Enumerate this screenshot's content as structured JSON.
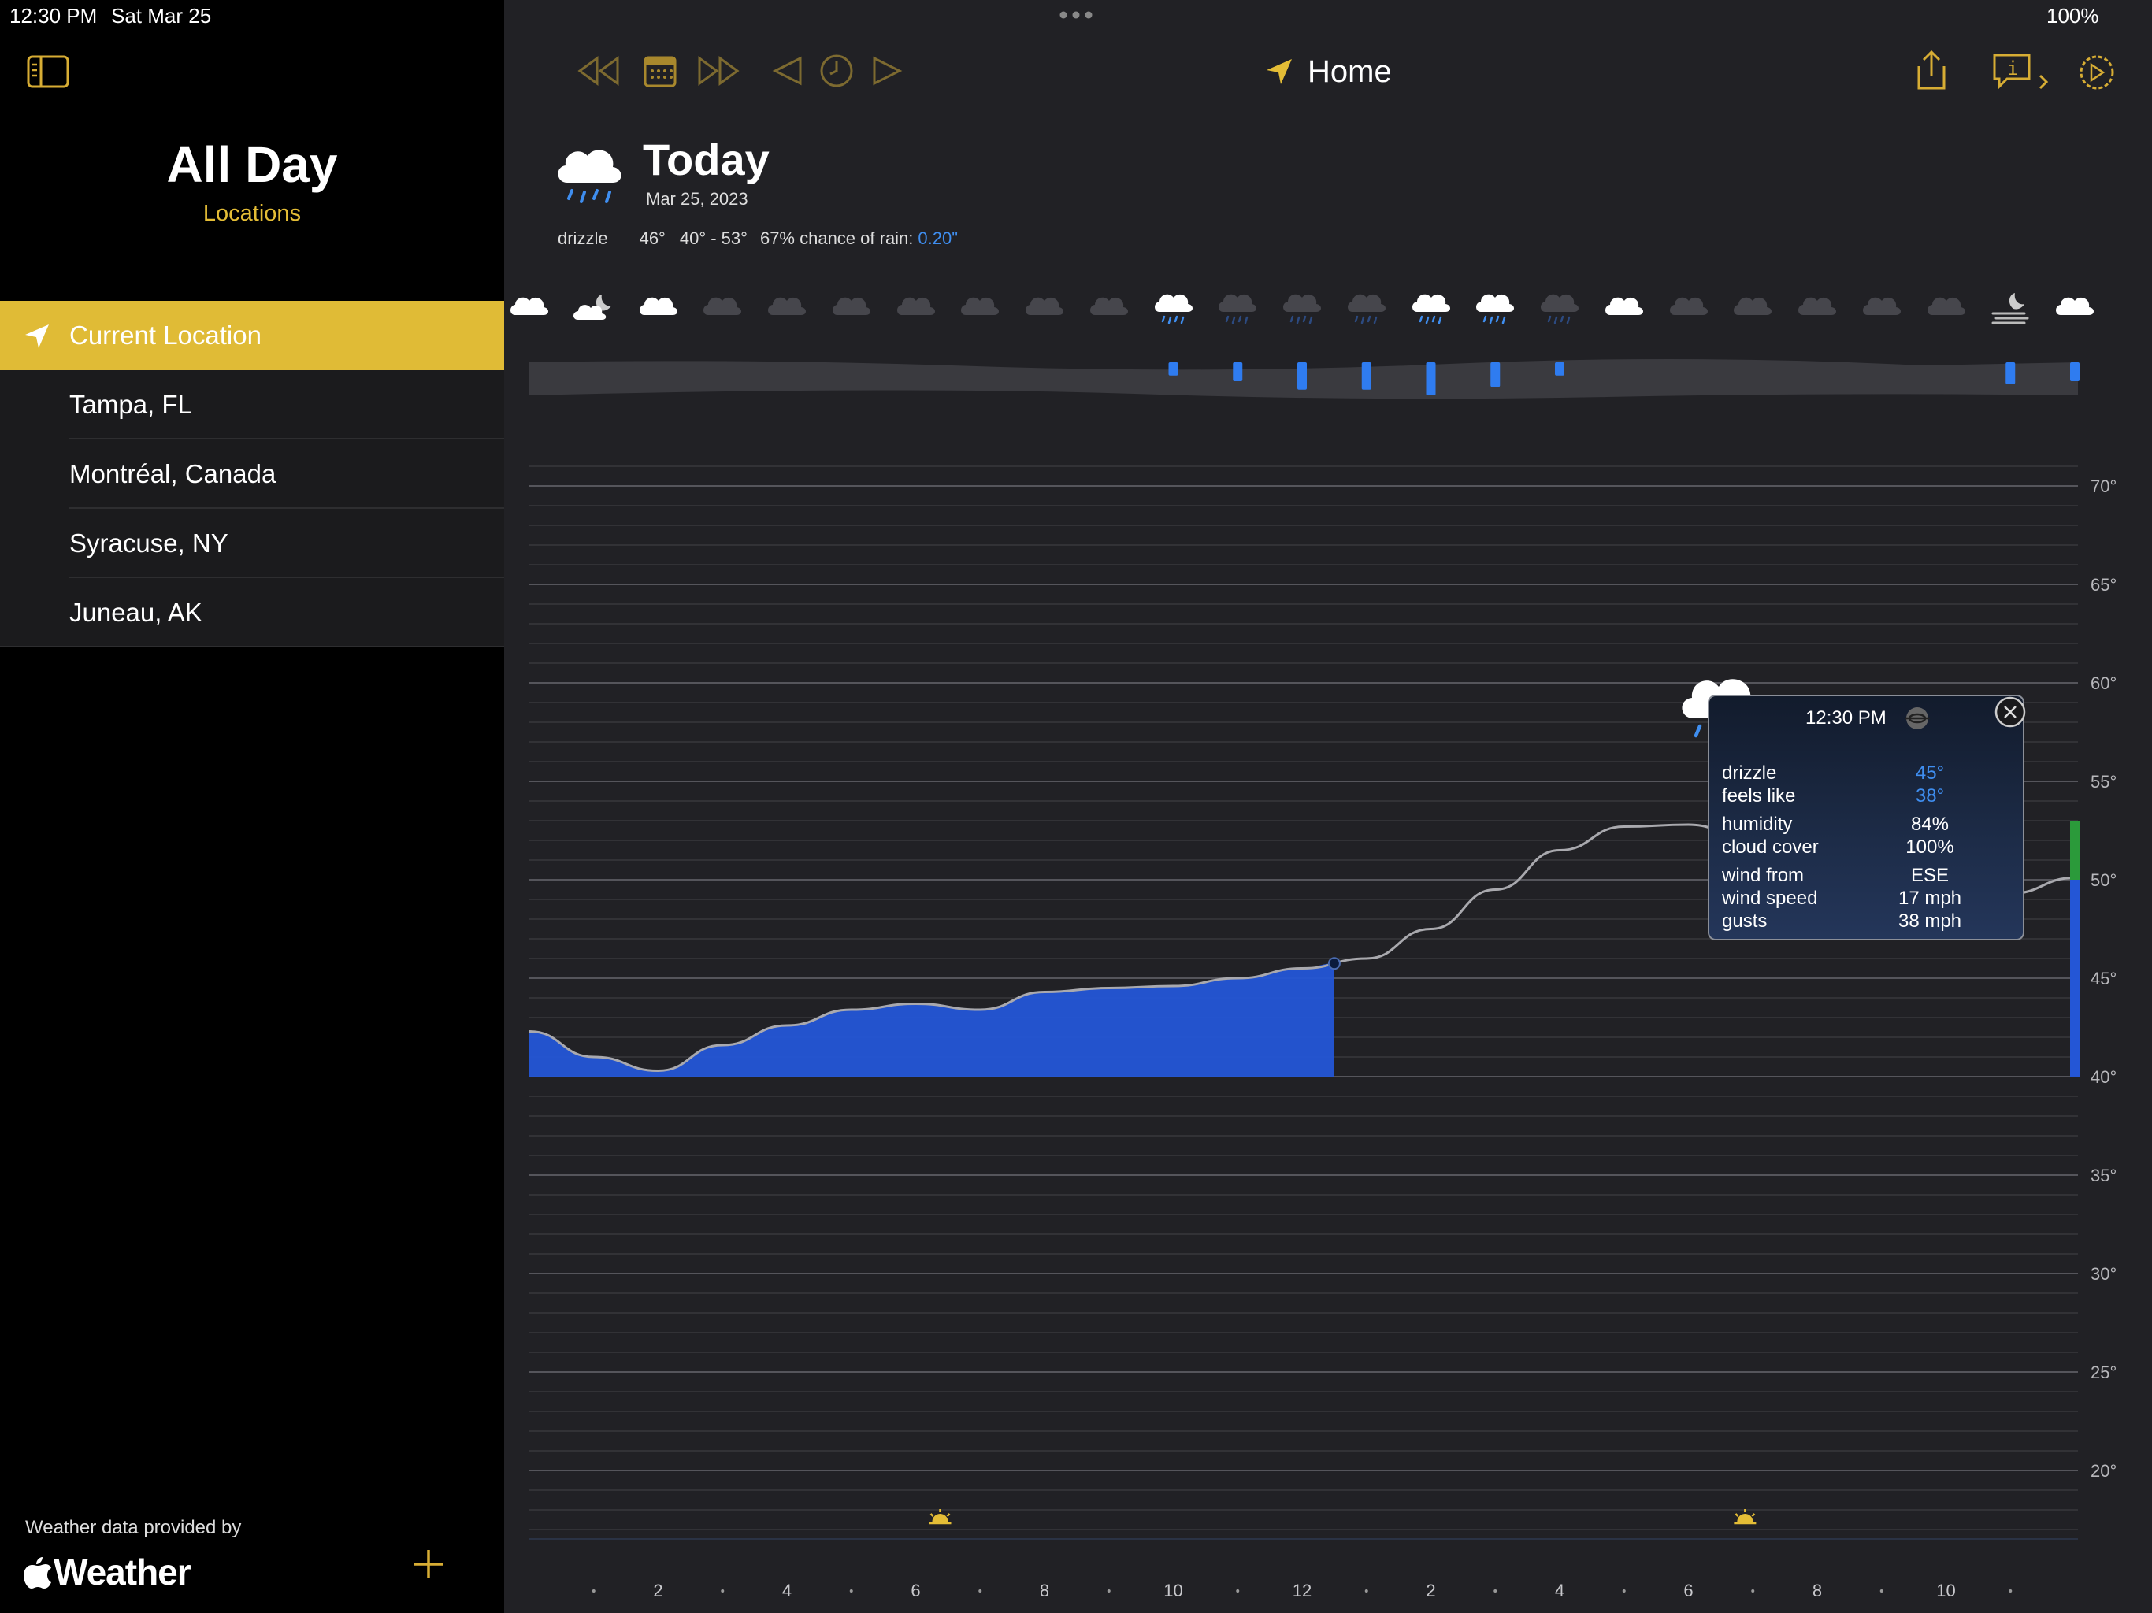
{
  "status_bar": {
    "time": "12:30 PM",
    "date": "Sat Mar 25",
    "battery": "100%"
  },
  "sidebar": {
    "title": "All Day",
    "subtitle": "Locations",
    "locations": [
      {
        "label": "Current Location",
        "active": true
      },
      {
        "label": "Tampa, FL"
      },
      {
        "label": "Montréal, Canada"
      },
      {
        "label": "Syracuse, NY"
      },
      {
        "label": "Juneau, AK"
      }
    ],
    "attribution": "Weather data provided by",
    "weather_brand": "Weather"
  },
  "toolbar": {
    "location_title": "Home"
  },
  "today": {
    "heading": "Today",
    "date": "Mar 25, 2023",
    "condition": "drizzle",
    "temp": "46°",
    "range": "40° - 53°",
    "rain_label": "67% chance of rain:",
    "rain_amount": "0.20\""
  },
  "tooltip": {
    "time": "12:30 PM",
    "rows": [
      {
        "label": "drizzle",
        "value": "45°",
        "highlight": true
      },
      {
        "label": "feels like",
        "value": "38°",
        "highlight": true
      },
      {
        "label": "humidity",
        "value": "84%"
      },
      {
        "label": "cloud cover",
        "value": "100%"
      },
      {
        "label": "wind from",
        "value": "ESE"
      },
      {
        "label": "wind speed",
        "value": "17 mph"
      },
      {
        "label": "gusts",
        "value": "38 mph"
      }
    ]
  },
  "hour_icons": [
    "cloud",
    "partly-cloudy-night",
    "cloud",
    "dark-cloud",
    "dark-cloud",
    "dark-cloud",
    "dark-cloud",
    "dark-cloud",
    "dark-cloud",
    "dark-cloud",
    "rain-cloud",
    "dark-drizzle",
    "dark-drizzle",
    "dark-drizzle",
    "rain-cloud",
    "rain-cloud",
    "dark-drizzle",
    "cloud",
    "dark-cloud",
    "dark-cloud",
    "dark-cloud",
    "dark-cloud",
    "dark-cloud",
    "fog-night",
    "cloud"
  ],
  "precip_bars": [
    0,
    0,
    0,
    0,
    0,
    0,
    0,
    0,
    0,
    0,
    0.3,
    0.5,
    0.8,
    0.8,
    1.0,
    0.7,
    0.3,
    0,
    0,
    0,
    0,
    0,
    0,
    0.6,
    0.5
  ],
  "chart_data": {
    "type": "area",
    "x": [
      0,
      1,
      2,
      3,
      4,
      5,
      6,
      7,
      8,
      9,
      10,
      11,
      12,
      13,
      14,
      15,
      16,
      17,
      18,
      19,
      20,
      21,
      22,
      23,
      24
    ],
    "series": [
      {
        "values": [
          42.3,
          41.0,
          40.3,
          41.6,
          42.6,
          43.4,
          43.7,
          43.4,
          44.3,
          44.5,
          44.6,
          45.0,
          45.5,
          46.0,
          47.5,
          49.5,
          51.5,
          52.7,
          52.8,
          52.0,
          50.3,
          49.3,
          48.2,
          49.3,
          50.1
        ]
      }
    ],
    "highlight_until_x": 12.5,
    "ylim": [
      17,
      72
    ],
    "y_ticks": [
      "70°",
      "65°",
      "60°",
      "55°",
      "50°",
      "45°",
      "40°",
      "35°",
      "30°",
      "25°",
      "20°"
    ],
    "y_tick_values": [
      70,
      65,
      60,
      55,
      50,
      45,
      40,
      35,
      30,
      25,
      20
    ],
    "x_tick_labels": [
      "2",
      "4",
      "6",
      "8",
      "10",
      "12",
      "2",
      "4",
      "6",
      "8",
      "10"
    ],
    "x_tick_positions": [
      2,
      4,
      6,
      8,
      10,
      12,
      14,
      16,
      18,
      20,
      22
    ],
    "temperature_scale": {
      "low": 40,
      "high": 53
    },
    "grid": true
  }
}
